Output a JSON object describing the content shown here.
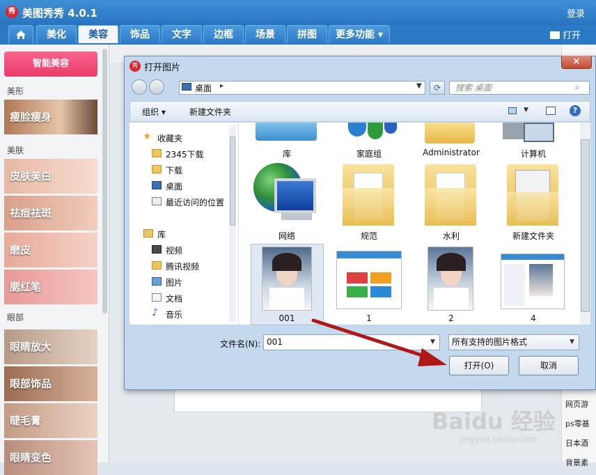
{
  "app": {
    "logo": "秀",
    "title": "美图秀秀 4.0.1",
    "login": "登录",
    "open": "打开"
  },
  "tabs": [
    "美化",
    "美容",
    "饰品",
    "文字",
    "边框",
    "场景",
    "拼图",
    "更多功能"
  ],
  "active_tab": "美容",
  "sidebar": {
    "smart_beauty": "智能美容",
    "sections": {
      "shape": "美形",
      "skin": "美肤",
      "eyes": "眼部"
    },
    "items": [
      "瘦脸瘦身",
      "皮肤美白",
      "祛痘祛斑",
      "磨皮",
      "腮红笔",
      "眼睛放大",
      "眼部饰品",
      "睫毛膏",
      "眼睛变色"
    ]
  },
  "right_links": [
    "网页游",
    "ps零基",
    "日本酒",
    "背景素"
  ],
  "dialog": {
    "title": "打开图片",
    "close": "×",
    "address": "桌面",
    "search_placeholder": "搜索 桌面",
    "organize": "组织 ▾",
    "new_folder": "新建文件夹",
    "nav": [
      "收藏夹",
      "2345下载",
      "下载",
      "桌面",
      "最近访问的位置",
      "库",
      "视频",
      "腾讯视频",
      "图片",
      "文档",
      "音乐"
    ],
    "files_row0": [
      "库",
      "家庭组",
      "Administrator",
      "计算机"
    ],
    "files_row1": [
      "网络",
      "规范",
      "水利",
      "新建文件夹"
    ],
    "files_row2": [
      "001",
      "1",
      "2",
      "4"
    ],
    "filename_label": "文件名(N):",
    "filename_value": "001",
    "filter": "所有支持的图片格式",
    "open_button": "打开(O)",
    "cancel_button": "取消"
  },
  "watermark": {
    "text": "Baidu 经验",
    "url": "jingyan.baidu.com"
  },
  "colors": {
    "title_bar": "#2b78c4",
    "accent_pink": "#ea3c6a",
    "arrow": "#b01818"
  }
}
